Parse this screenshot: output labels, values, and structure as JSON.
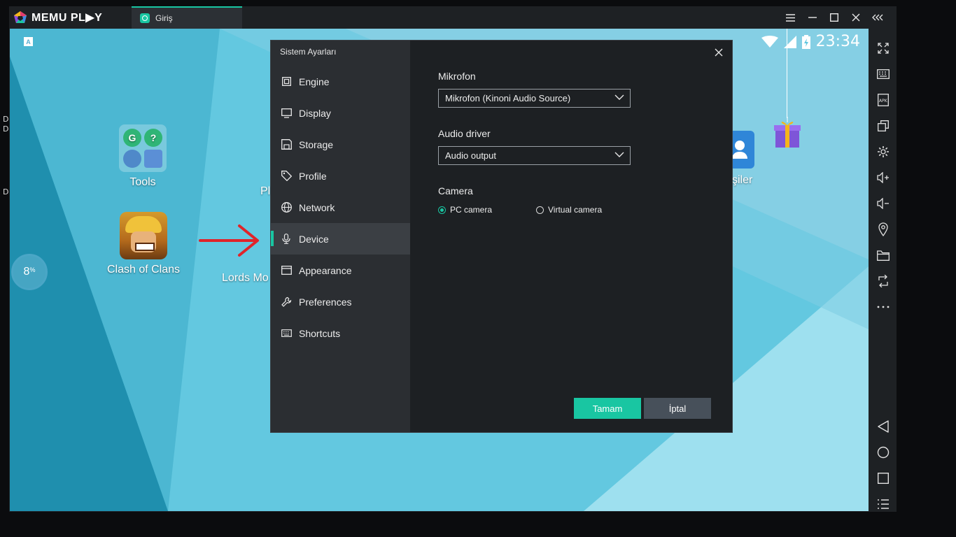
{
  "window": {
    "brand": "MEMU PL▶Y",
    "tab_label": "Giriş"
  },
  "android": {
    "time": "23:34",
    "input_badge": "A",
    "boost_value": "8",
    "boost_unit": "%",
    "apps": [
      {
        "label": "Tools"
      },
      {
        "label": "Clash of Clans"
      },
      {
        "label": "Lords Mo"
      },
      {
        "label": "Pl"
      },
      {
        "label": "şiler"
      }
    ]
  },
  "desktop_edge": [
    "D",
    "D",
    "D"
  ],
  "dialog": {
    "title": "Sistem Ayarları",
    "nav": [
      {
        "label": "Engine",
        "icon": "cpu-icon"
      },
      {
        "label": "Display",
        "icon": "monitor-icon"
      },
      {
        "label": "Storage",
        "icon": "disk-icon"
      },
      {
        "label": "Profile",
        "icon": "tag-icon"
      },
      {
        "label": "Network",
        "icon": "globe-icon"
      },
      {
        "label": "Device",
        "icon": "microphone-icon",
        "active": true
      },
      {
        "label": "Appearance",
        "icon": "window-icon"
      },
      {
        "label": "Preferences",
        "icon": "wrench-icon"
      },
      {
        "label": "Shortcuts",
        "icon": "keyboard-icon"
      }
    ],
    "microphone": {
      "label": "Mikrofon",
      "value": "Mikrofon (Kinoni Audio Source)"
    },
    "audio_driver": {
      "label": "Audio driver",
      "value": "Audio output"
    },
    "camera": {
      "label": "Camera",
      "options": [
        {
          "label": "PC camera",
          "selected": true
        },
        {
          "label": "Virtual camera",
          "selected": false
        }
      ]
    },
    "ok_label": "Tamam",
    "cancel_label": "İptal"
  },
  "colors": {
    "accent": "#19c6a2",
    "dialog_bg": "#1d2023",
    "nav_bg": "#2b2e32",
    "annotation_arrow": "#e0242a"
  }
}
